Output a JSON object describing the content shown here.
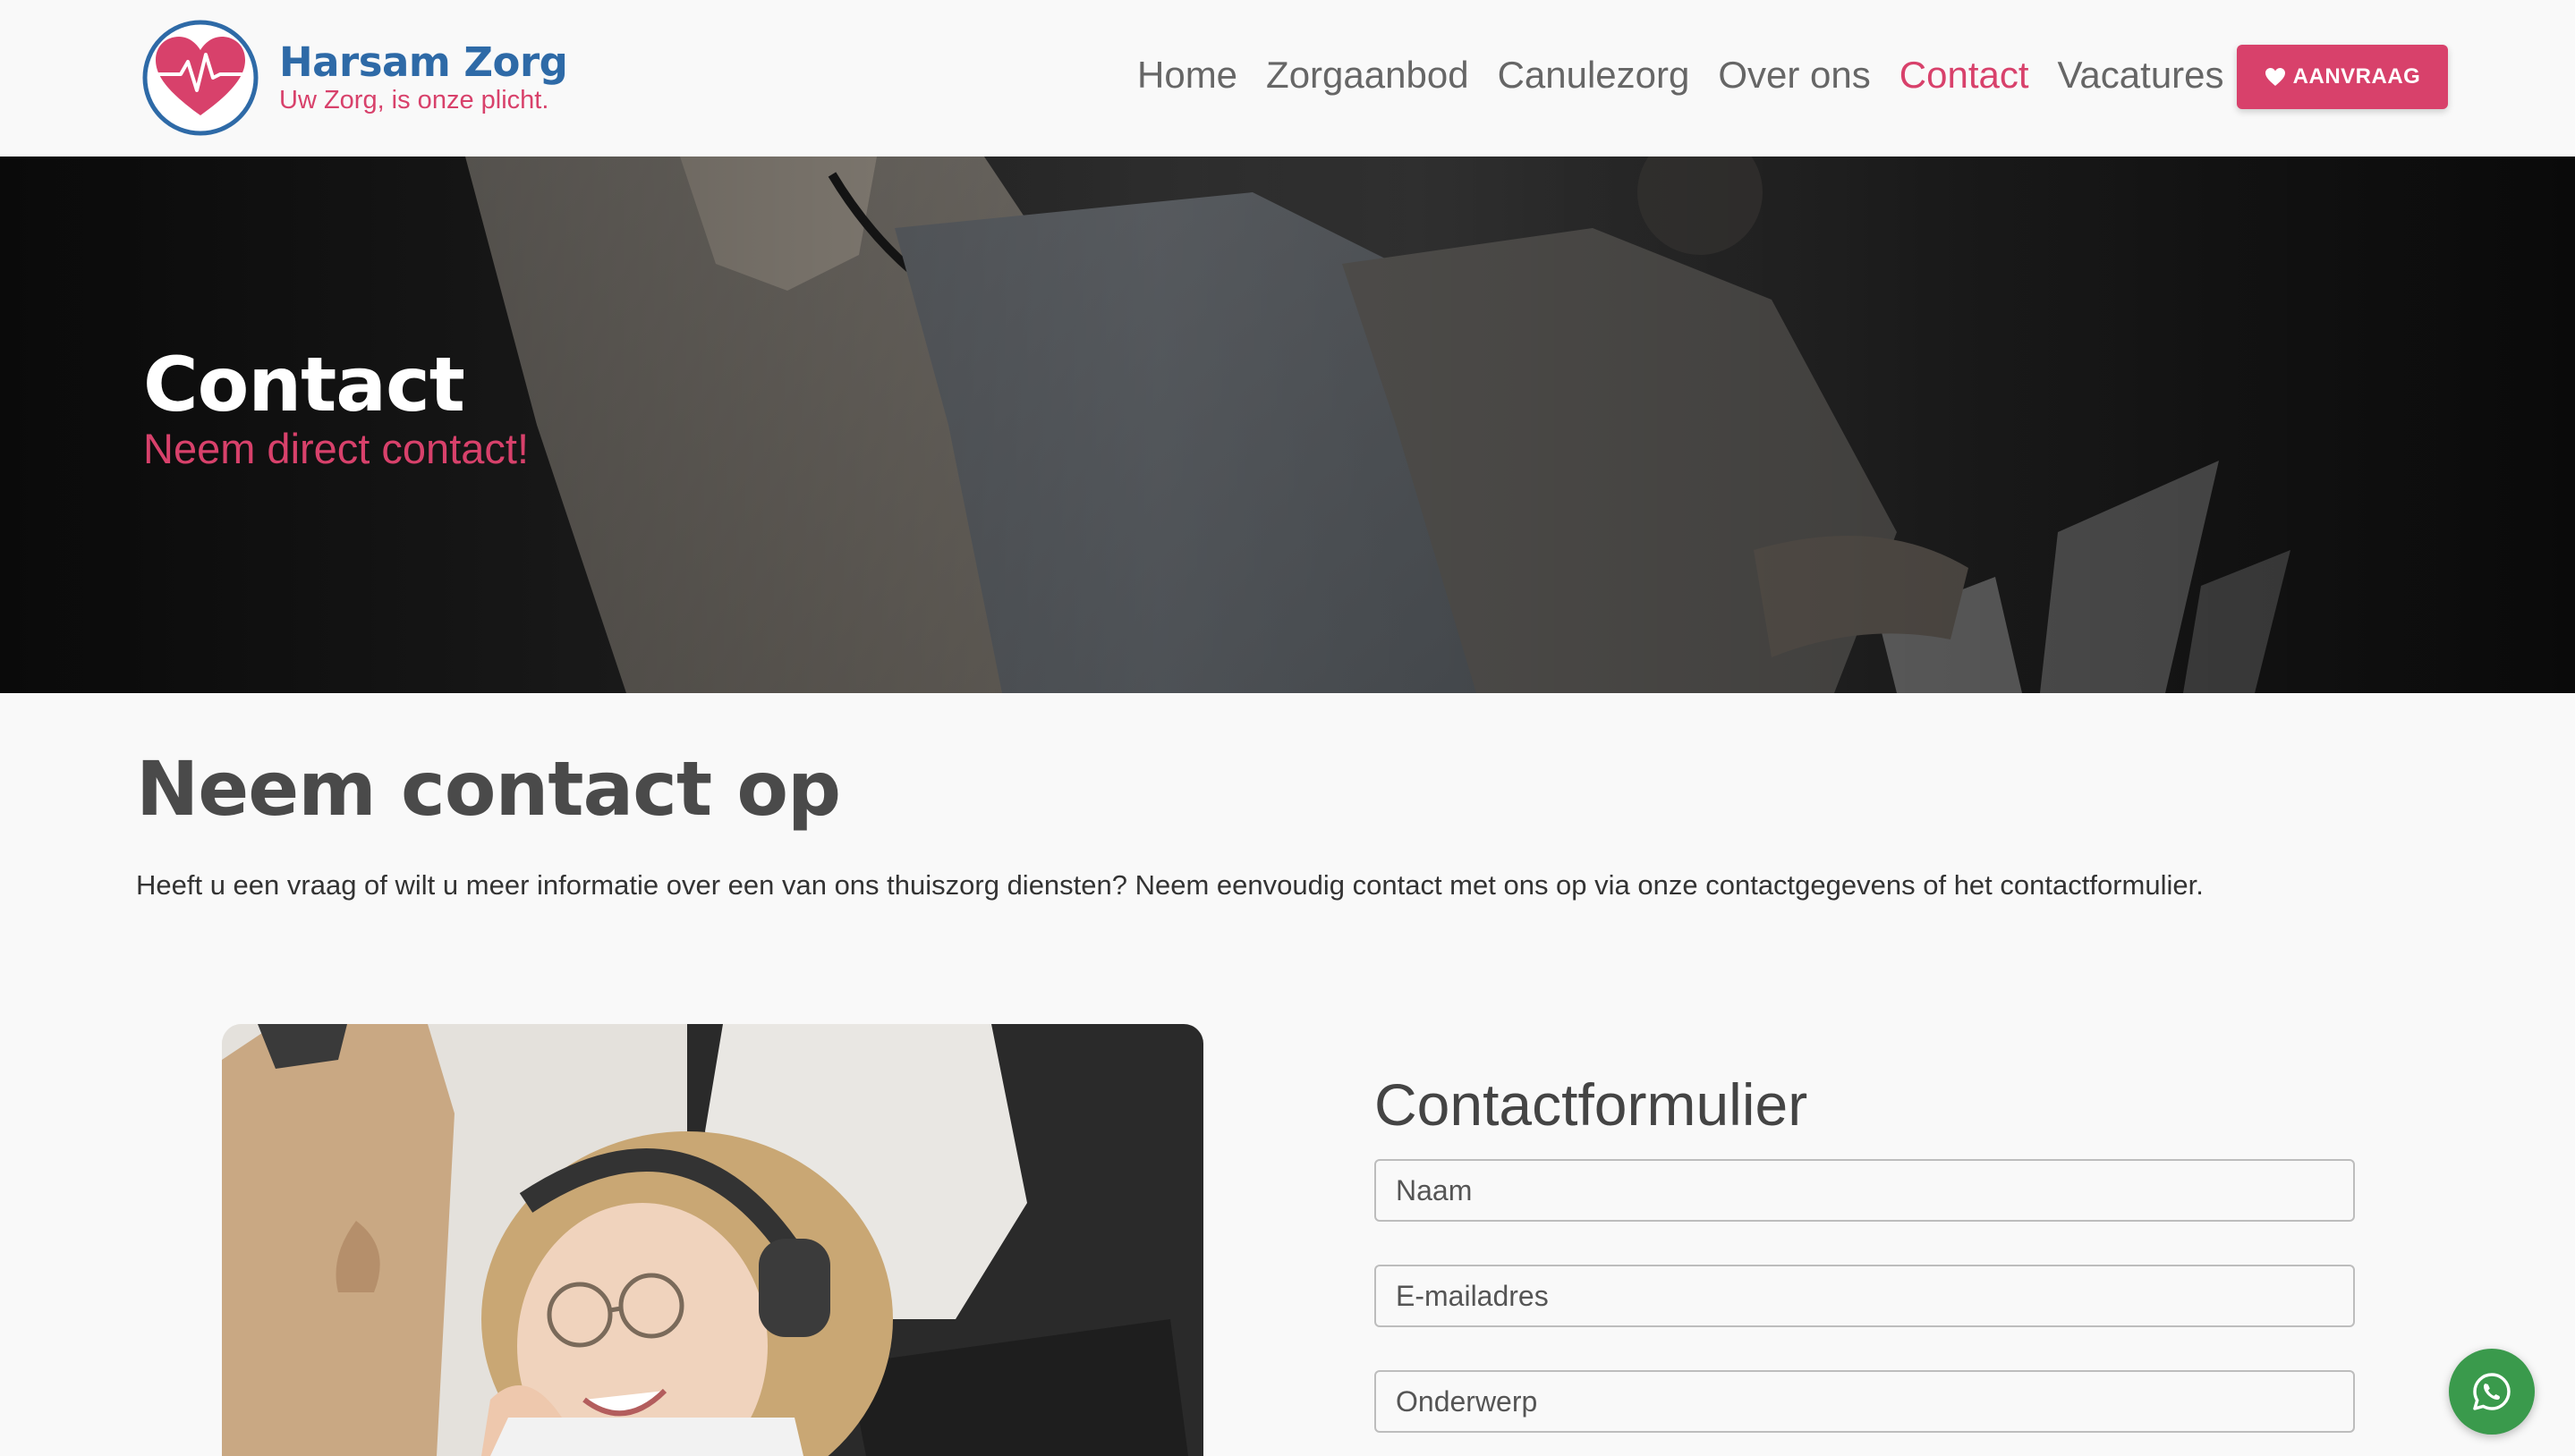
{
  "brand": {
    "name": "Harsam Zorg",
    "tagline": "Uw Zorg, is onze plicht.",
    "logo_icon": "heart-pulse-icon",
    "primary_color": "#d8416b",
    "secondary_color": "#2e6aa7"
  },
  "nav": {
    "items": [
      {
        "label": "Home",
        "active": false
      },
      {
        "label": "Zorgaanbod",
        "active": false
      },
      {
        "label": "Canulezorg",
        "active": false
      },
      {
        "label": "Over ons",
        "active": false
      },
      {
        "label": "Contact",
        "active": true
      },
      {
        "label": "Vacatures",
        "active": false
      }
    ],
    "cta_label": "AANVRAAG",
    "cta_icon": "heart-icon"
  },
  "hero": {
    "title": "Contact",
    "subtitle": "Neem direct contact!"
  },
  "intro": {
    "title": "Neem contact op",
    "text": "Heeft u een vraag of wilt u meer informatie over een van ons thuiszorg diensten? Neem eenvoudig contact met ons op via onze contactgegevens of het contactformulier."
  },
  "form": {
    "title": "Contactformulier",
    "name_placeholder": "Naam",
    "email_placeholder": "E-mailadres",
    "subject_placeholder": "Onderwerp"
  },
  "floating": {
    "whatsapp_icon": "whatsapp-icon",
    "whatsapp_color": "#3a9a4c"
  }
}
